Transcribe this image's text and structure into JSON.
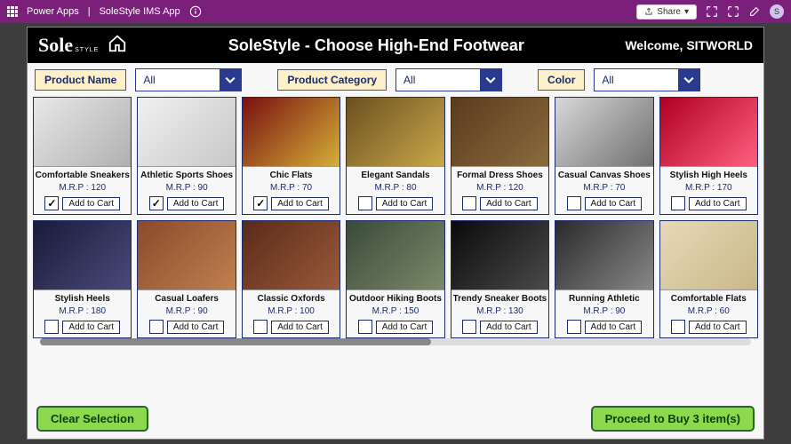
{
  "topbar": {
    "app_label": "Power Apps",
    "app_name": "SoleStyle IMS App",
    "share_label": "Share",
    "avatar_initial": "S"
  },
  "header": {
    "logo_main": "Sole",
    "logo_sub": "STYLE",
    "title": "SoleStyle - Choose High-End Footwear",
    "welcome": "Welcome, SITWORLD"
  },
  "filters": [
    {
      "label": "Product Name",
      "value": "All"
    },
    {
      "label": "Product Category",
      "value": "All"
    },
    {
      "label": "Color",
      "value": "All"
    }
  ],
  "add_to_cart_label": "Add to Cart",
  "mrp_prefix": "M.R.P : ",
  "products": [
    {
      "name": "Comfortable Sneakers",
      "mrp": 120,
      "checked": true,
      "tint": 0
    },
    {
      "name": "Athletic Sports Shoes",
      "mrp": 90,
      "checked": true,
      "tint": 1
    },
    {
      "name": "Chic Flats",
      "mrp": 70,
      "checked": true,
      "tint": 2
    },
    {
      "name": "Elegant Sandals",
      "mrp": 80,
      "checked": false,
      "tint": 3
    },
    {
      "name": "Formal Dress Shoes",
      "mrp": 120,
      "checked": false,
      "tint": 4
    },
    {
      "name": "Casual Canvas Shoes",
      "mrp": 70,
      "checked": false,
      "tint": 5
    },
    {
      "name": "Stylish High Heels",
      "mrp": 170,
      "checked": false,
      "tint": 6
    },
    {
      "name": "Stylish Heels",
      "mrp": 180,
      "checked": false,
      "tint": 7
    },
    {
      "name": "Casual Loafers",
      "mrp": 90,
      "checked": false,
      "tint": 8
    },
    {
      "name": "Classic Oxfords",
      "mrp": 100,
      "checked": false,
      "tint": 9
    },
    {
      "name": "Outdoor Hiking Boots",
      "mrp": 150,
      "checked": false,
      "tint": 10
    },
    {
      "name": "Trendy Sneaker Boots",
      "mrp": 130,
      "checked": false,
      "tint": 11
    },
    {
      "name": "Running Athletic Shoes",
      "mrp": 90,
      "checked": false,
      "tint": 12
    },
    {
      "name": "Comfortable Flats",
      "mrp": 60,
      "checked": false,
      "tint": 13
    }
  ],
  "footer": {
    "clear_label": "Clear Selection",
    "proceed_label": "Proceed to Buy 3 item(s)"
  }
}
